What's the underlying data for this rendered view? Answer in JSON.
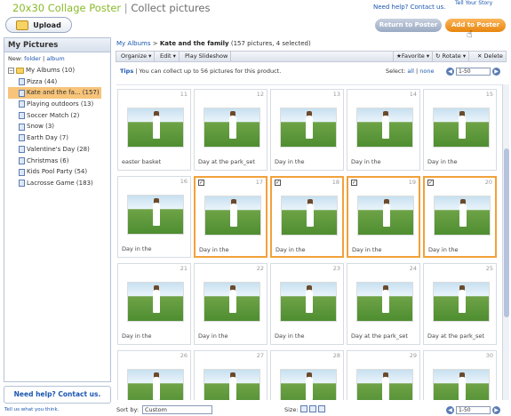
{
  "header": {
    "title_part1": "20x30 Collage Poster",
    "separator": "|",
    "title_part2": "Collect pictures",
    "help_link": "Need help? Contact us.",
    "tell_story": "Tell Your Story",
    "upload_label": "Upload",
    "return_label": "Return to Poster",
    "add_label": "Add to Poster"
  },
  "sidebar": {
    "title": "My Pictures",
    "new_label": "New:",
    "new_folder": "folder",
    "new_album": "album",
    "root": "My Albums (10)",
    "items": [
      {
        "label": "Pizza (44)"
      },
      {
        "label": "Kate and the fa... (157)"
      },
      {
        "label": "Playing outdoors (13)"
      },
      {
        "label": "Soccer Match (2)"
      },
      {
        "label": "Snow (3)"
      },
      {
        "label": "Earth Day (7)"
      },
      {
        "label": "Valentine's Day (28)"
      },
      {
        "label": "Christmas (6)"
      },
      {
        "label": "Kids Pool Party (54)"
      },
      {
        "label": "Lacrosse Game (183)"
      }
    ],
    "help": "Need help? Contact us.",
    "tell_us": "Tell us what you think."
  },
  "breadcrumb": {
    "root": "My Albums",
    "arrow": ">",
    "name": "Kate and the family",
    "count": "(157 pictures, 4 selected)"
  },
  "toolbar": {
    "organize": "Organize ▾",
    "edit": "Edit ▾",
    "slideshow": "Play Slideshow",
    "favorite": "★Favorite ▾",
    "rotate": "↻ Rotate ▾",
    "delete": "✕ Delete"
  },
  "tips": {
    "label": "Tips",
    "text": "| You can collect up to 56 pictures for this product."
  },
  "select": {
    "label": "Select:",
    "all": "all",
    "sep": "|",
    "none": "none"
  },
  "pager": {
    "range": "1-50"
  },
  "tiles": [
    {
      "num": "11",
      "caption": "easter basket",
      "selected": false
    },
    {
      "num": "12",
      "caption": "Day at the park_set",
      "selected": false
    },
    {
      "num": "13",
      "caption": "Day in the",
      "selected": false
    },
    {
      "num": "14",
      "caption": "Day in the",
      "selected": false
    },
    {
      "num": "15",
      "caption": "Day in the",
      "selected": false
    },
    {
      "num": "16",
      "caption": "Day in the",
      "selected": false
    },
    {
      "num": "17",
      "caption": "Day in the",
      "selected": true
    },
    {
      "num": "18",
      "caption": "Day in the",
      "selected": true
    },
    {
      "num": "19",
      "caption": "Day in the",
      "selected": true
    },
    {
      "num": "20",
      "caption": "Day in the",
      "selected": true
    },
    {
      "num": "21",
      "caption": "Day in the",
      "selected": false
    },
    {
      "num": "22",
      "caption": "Day in the",
      "selected": false
    },
    {
      "num": "23",
      "caption": "Day in the",
      "selected": false
    },
    {
      "num": "24",
      "caption": "Day at the park_set",
      "selected": false
    },
    {
      "num": "25",
      "caption": "Day at the park_set",
      "selected": false
    },
    {
      "num": "26",
      "caption": "",
      "selected": false
    },
    {
      "num": "27",
      "caption": "",
      "selected": false
    },
    {
      "num": "28",
      "caption": "",
      "selected": false
    },
    {
      "num": "29",
      "caption": "",
      "selected": false
    },
    {
      "num": "30",
      "caption": "",
      "selected": false
    }
  ],
  "bottom": {
    "sort_label": "Sort by:",
    "sort_value": "Custom",
    "size_label": "Size:",
    "range": "1-50"
  }
}
